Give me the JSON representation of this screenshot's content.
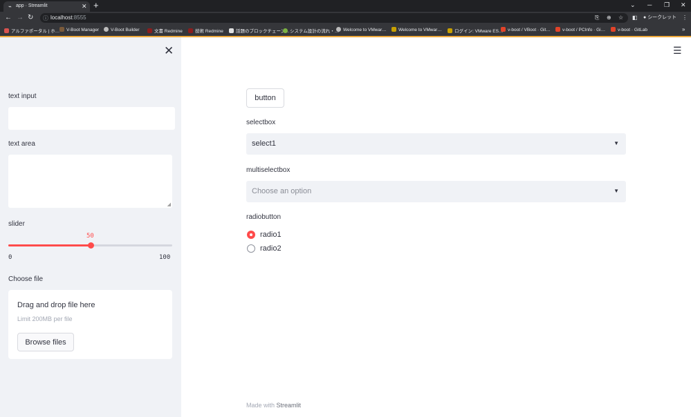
{
  "browser": {
    "tab_title": "app · Streamlit",
    "tab_favicon": "streamlit-icon",
    "url_host": "localhost",
    "url_port": ":8555",
    "profile_label": "シークレット",
    "bookmarks": [
      "アルファポータル | ホ…",
      "V-Boot Manager",
      "V-Boot Builder",
      "文書 Redmine",
      "技術 Redmine",
      "話題のブロックチェーン…",
      "システム設計の流れ・…",
      "Welcome to VMwar…",
      "Welcome to VMwar…",
      "ログイン: VMware ES…",
      "v-boot / VBoot · Git…",
      "v-boot / PCInfo · Gi…",
      "v-boot · GitLab"
    ],
    "accent_color": "#f0a93a"
  },
  "sidebar": {
    "text_input_label": "text input",
    "text_input_value": "",
    "text_area_label": "text area",
    "text_area_value": "",
    "slider_label": "slider",
    "slider_value": 50,
    "slider_min": 0,
    "slider_max": 100,
    "slider_value_text": "50",
    "slider_min_text": "0",
    "slider_max_text": "100",
    "file_label": "Choose file",
    "dropzone_title": "Drag and drop file here",
    "dropzone_limit": "Limit 200MB per file",
    "browse_label": "Browse files"
  },
  "main": {
    "button_label": "button",
    "selectbox_label": "selectbox",
    "selectbox_value": "select1",
    "multiselect_label": "multiselectbox",
    "multiselect_placeholder": "Choose an option",
    "radio_label": "radiobutton",
    "radio_options": [
      "radio1",
      "radio2"
    ],
    "radio_selected": "radio1",
    "footer_prefix": "Made with",
    "footer_brand": "Streamlit"
  },
  "colors": {
    "primary": "#ff4b4b",
    "sidebar_bg": "#f0f2f6",
    "text": "#31333f"
  }
}
